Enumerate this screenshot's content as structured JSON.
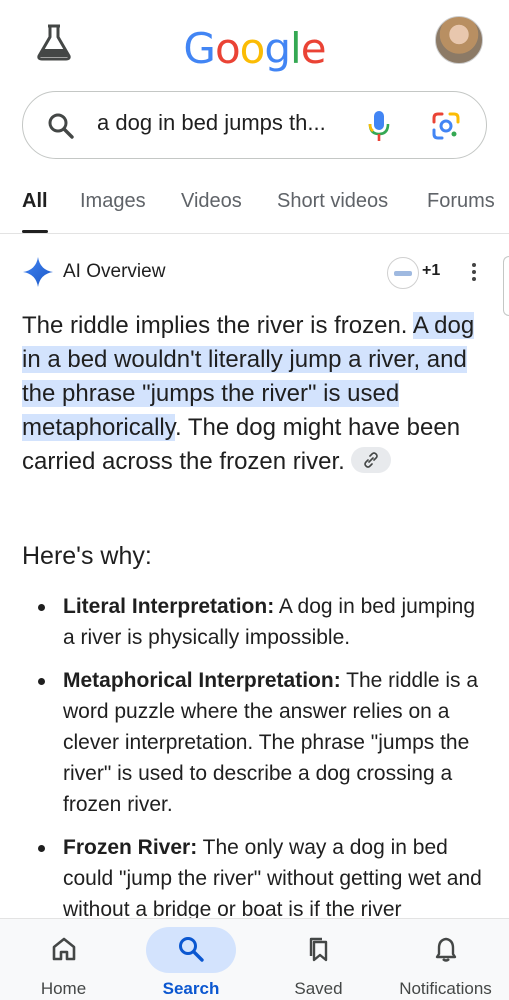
{
  "header": {
    "logo_letters": [
      {
        "ch": "G",
        "color": "#4285F4"
      },
      {
        "ch": "o",
        "color": "#EA4335"
      },
      {
        "ch": "o",
        "color": "#FBBC05"
      },
      {
        "ch": "g",
        "color": "#4285F4"
      },
      {
        "ch": "l",
        "color": "#34A853"
      },
      {
        "ch": "e",
        "color": "#EA4335"
      }
    ],
    "labs_icon": "flask-icon",
    "avatar": "profile-avatar"
  },
  "search": {
    "query": "a dog in bed jumps th...",
    "icons": [
      "search-icon",
      "microphone-icon",
      "google-lens-icon"
    ]
  },
  "tabs": [
    {
      "label": "All",
      "active": true
    },
    {
      "label": "Images",
      "active": false
    },
    {
      "label": "Videos",
      "active": false
    },
    {
      "label": "Short videos",
      "active": false
    },
    {
      "label": "Forums",
      "active": false
    }
  ],
  "ai_overview": {
    "title": "AI Overview",
    "source_count": "+1",
    "answer": {
      "plain_1": "The riddle implies the river is frozen. ",
      "highlight": "A dog in a bed wouldn't literally jump a river, and the phrase \"jumps the river\" is used metaphorically",
      "plain_2": ". The dog might have been carried across the frozen river."
    },
    "why_heading": "Here's why:",
    "bullets": [
      {
        "term": "Literal Interpretation:",
        "text": " A dog in bed jumping a river is physically impossible."
      },
      {
        "term": "Metaphorical Interpretation:",
        "text": " The riddle is a word puzzle where the answer relies on a clever interpretation. The phrase \"jumps the river\" is used to describe a dog crossing a frozen river."
      },
      {
        "term": "Frozen River:",
        "text": " The only way a dog in bed could \"jump the river\" without getting wet and without a bridge or boat is if the river"
      }
    ]
  },
  "bottom_nav": [
    {
      "label": "Home",
      "icon": "home-icon",
      "active": false
    },
    {
      "label": "Search",
      "icon": "search-icon",
      "active": true
    },
    {
      "label": "Saved",
      "icon": "saved-icon",
      "active": false
    },
    {
      "label": "Notifications",
      "icon": "bell-icon",
      "active": false
    }
  ],
  "colors": {
    "accent": "#0b57d0",
    "highlight": "#d3e3fd"
  }
}
